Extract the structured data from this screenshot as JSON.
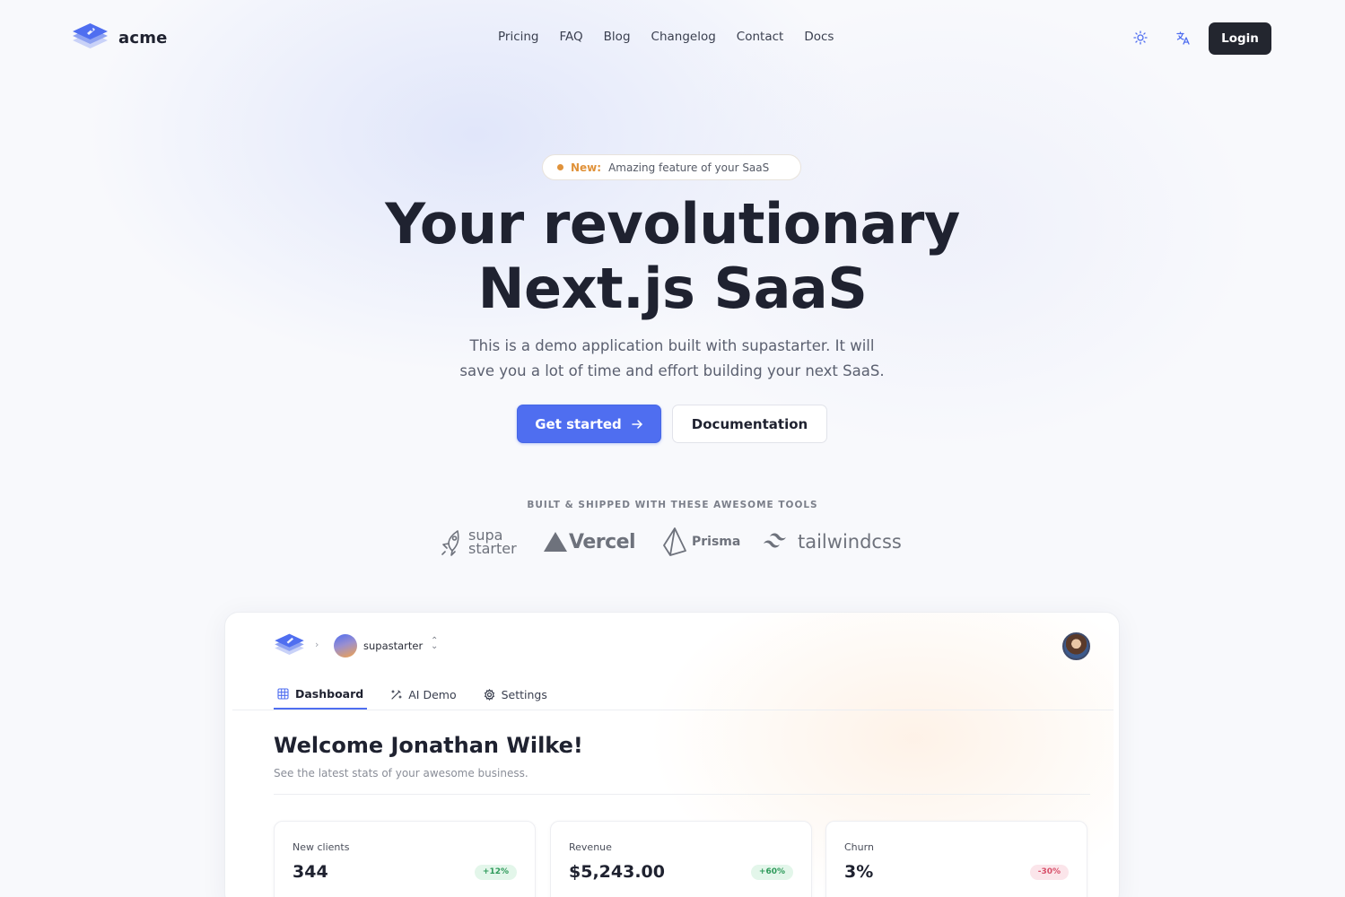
{
  "brand": {
    "name": "acme"
  },
  "nav": {
    "links": [
      "Pricing",
      "FAQ",
      "Blog",
      "Changelog",
      "Contact",
      "Docs"
    ],
    "theme_icon": "sun-icon",
    "language_icon": "translate-icon",
    "login_label": "Login"
  },
  "hero": {
    "badge_new": "New:",
    "badge_text": "Amazing feature of your SaaS",
    "title_line1": "Your revolutionary",
    "title_line2": "Next.js SaaS",
    "subtitle_line1": "This is a demo application built with supastarter. It will",
    "subtitle_line2": "save you a lot of time and effort building your next SaaS.",
    "primary_cta": "Get started",
    "secondary_cta": "Documentation"
  },
  "tools": {
    "heading": "BUILT & SHIPPED WITH THESE AWESOME TOOLS",
    "logos": [
      {
        "name": "supastarter",
        "line1": "supa",
        "line2": "starter"
      },
      {
        "name": "Vercel",
        "text": "Vercel"
      },
      {
        "name": "Prisma",
        "text": "Prisma"
      },
      {
        "name": "tailwindcss",
        "text": "tailwindcss"
      }
    ]
  },
  "preview": {
    "org_name": "supastarter",
    "tabs": [
      {
        "label": "Dashboard",
        "icon": "grid-icon",
        "active": true
      },
      {
        "label": "AI Demo",
        "icon": "magic-wand-icon",
        "active": false
      },
      {
        "label": "Settings",
        "icon": "gear-icon",
        "active": false
      }
    ],
    "welcome_title": "Welcome Jonathan Wilke!",
    "welcome_subtitle": "See the latest stats of your awesome business.",
    "stats": [
      {
        "label": "New clients",
        "value": "344",
        "delta": "+12%",
        "trend": "up"
      },
      {
        "label": "Revenue",
        "value": "$5,243.00",
        "delta": "+60%",
        "trend": "up"
      },
      {
        "label": "Churn",
        "value": "3%",
        "delta": "-30%",
        "trend": "down"
      }
    ]
  },
  "colors": {
    "accent": "#4f6ef0",
    "badge_accent": "#e0923a",
    "dark_button": "#23262f",
    "positive": "#2e9a5a",
    "negative": "#d8506a"
  }
}
